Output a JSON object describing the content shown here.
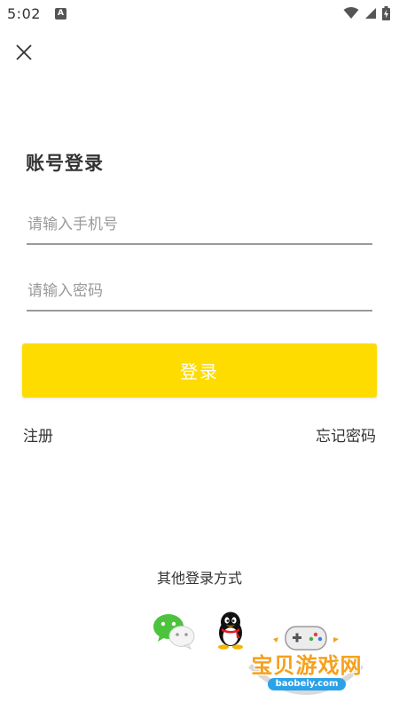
{
  "status_bar": {
    "time": "5:02",
    "notification_badge": "A",
    "icons": [
      "wifi-icon",
      "signal-icon",
      "battery-charging-icon"
    ]
  },
  "header": {
    "close_icon": "close-icon"
  },
  "login": {
    "title": "账号登录",
    "phone_placeholder": "请输入手机号",
    "phone_value": "",
    "password_placeholder": "请输入密码",
    "password_value": "",
    "submit_label": "登录",
    "register_label": "注册",
    "forgot_label": "忘记密码"
  },
  "other_login": {
    "title": "其他登录方式",
    "methods": [
      {
        "name": "wechat",
        "icon": "wechat-icon"
      },
      {
        "name": "qq",
        "icon": "qq-icon"
      }
    ]
  },
  "watermark": {
    "brand": "宝贝游戏网",
    "url": "baobeiy.com"
  },
  "colors": {
    "accent": "#fedc00",
    "text": "#333333",
    "placeholder": "#9a9a9a",
    "wechat_green": "#4cc33d",
    "watermark_orange": "#f6a11b"
  }
}
